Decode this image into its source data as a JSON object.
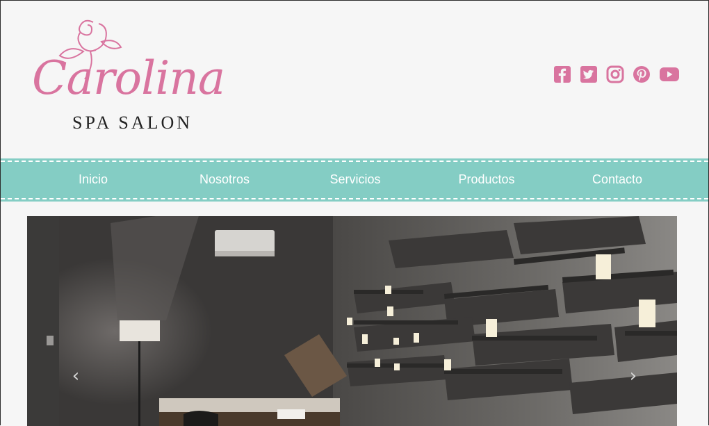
{
  "brand": {
    "script_name": "Carolina",
    "subtitle": "SPA SALON",
    "accent_color": "#d9749f"
  },
  "social": [
    {
      "icon": "facebook-icon"
    },
    {
      "icon": "twitter-icon"
    },
    {
      "icon": "instagram-icon"
    },
    {
      "icon": "pinterest-icon"
    },
    {
      "icon": "youtube-icon"
    }
  ],
  "nav": {
    "background": "#84cdc4",
    "items": [
      {
        "label": "Inicio"
      },
      {
        "label": "Nosotros"
      },
      {
        "label": "Servicios"
      },
      {
        "label": "Productos"
      },
      {
        "label": "Contacto"
      }
    ]
  },
  "carousel": {
    "prev_glyph": "‹",
    "next_glyph": "›"
  }
}
